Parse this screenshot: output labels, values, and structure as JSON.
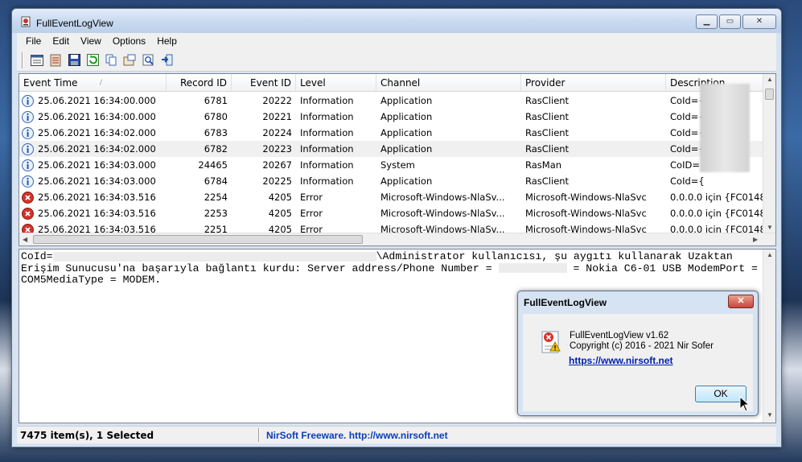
{
  "window": {
    "title": "FullEventLogView",
    "min_glyph": "▁",
    "max_glyph": "▭",
    "close_glyph": "✕"
  },
  "menu": [
    "File",
    "Edit",
    "View",
    "Options",
    "Help"
  ],
  "toolbar": {
    "icons": [
      "properties-icon",
      "event-log-icon",
      "save-icon",
      "refresh-icon",
      "copy-icon",
      "options-icon",
      "find-icon",
      "exit-icon"
    ]
  },
  "grid": {
    "columns": [
      "Event Time",
      "Record ID",
      "Event ID",
      "Level",
      "Channel",
      "Provider",
      "Description"
    ],
    "sort_glyph": "/",
    "rows": [
      {
        "kind": "info",
        "time": "25.06.2021 16:34:00.000",
        "record": "6781",
        "event": "20222",
        "level": "Information",
        "channel": "Application",
        "provider": "RasClient",
        "desc": "CoId={"
      },
      {
        "kind": "info",
        "time": "25.06.2021 16:34:00.000",
        "record": "6780",
        "event": "20221",
        "level": "Information",
        "channel": "Application",
        "provider": "RasClient",
        "desc": "CoId={"
      },
      {
        "kind": "info",
        "time": "25.06.2021 16:34:02.000",
        "record": "6783",
        "event": "20224",
        "level": "Information",
        "channel": "Application",
        "provider": "RasClient",
        "desc": "CoId={"
      },
      {
        "kind": "info",
        "time": "25.06.2021 16:34:02.000",
        "record": "6782",
        "event": "20223",
        "level": "Information",
        "channel": "Application",
        "provider": "RasClient",
        "desc": "CoId={"
      },
      {
        "kind": "info",
        "time": "25.06.2021 16:34:03.000",
        "record": "24465",
        "event": "20267",
        "level": "Information",
        "channel": "System",
        "provider": "RasMan",
        "desc": "CoID={"
      },
      {
        "kind": "info",
        "time": "25.06.2021 16:34:03.000",
        "record": "6784",
        "event": "20225",
        "level": "Information",
        "channel": "Application",
        "provider": "RasClient",
        "desc": "CoId={"
      },
      {
        "kind": "error",
        "time": "25.06.2021 16:34:03.516",
        "record": "2254",
        "event": "4205",
        "level": "Error",
        "channel": "Microsoft-Windows-NlaSv...",
        "provider": "Microsoft-Windows-NlaSvc",
        "desc": "0.0.0.0 için {FC0148"
      },
      {
        "kind": "error",
        "time": "25.06.2021 16:34:03.516",
        "record": "2253",
        "event": "4205",
        "level": "Error",
        "channel": "Microsoft-Windows-NlaSv...",
        "provider": "Microsoft-Windows-NlaSvc",
        "desc": "0.0.0.0 için {FC0148"
      },
      {
        "kind": "error",
        "time": "25.06.2021 16:34:03.516",
        "record": "2251",
        "event": "4205",
        "level": "Error",
        "channel": "Microsoft-Windows-NlaSv...",
        "provider": "Microsoft-Windows-NlaSvc",
        "desc": "0.0.0.0 için {FC0148"
      }
    ]
  },
  "details": {
    "line1a": "CoId=",
    "line1b": "\\Administrator kullanıcısı, şu aygıtı kullanarak Uzaktan",
    "line2a": "Erişim Sunucusu'na başarıyla bağlantı kurdu: Server address/Phone Number =",
    "line2b": "= Nokia C6-01 USB ModemPort =",
    "line3": "COM5MediaType = MODEM."
  },
  "status": {
    "items": "7475 item(s), 1 Selected",
    "credit": "NirSoft Freeware.  http://www.nirsoft.net"
  },
  "dialog": {
    "title": "FullEventLogView",
    "close_glyph": "✕",
    "version": "FullEventLogView v1.62",
    "copyright": "Copyright (c) 2016 - 2021 Nir Sofer",
    "link": "https://www.nirsoft.net",
    "ok": "OK"
  }
}
